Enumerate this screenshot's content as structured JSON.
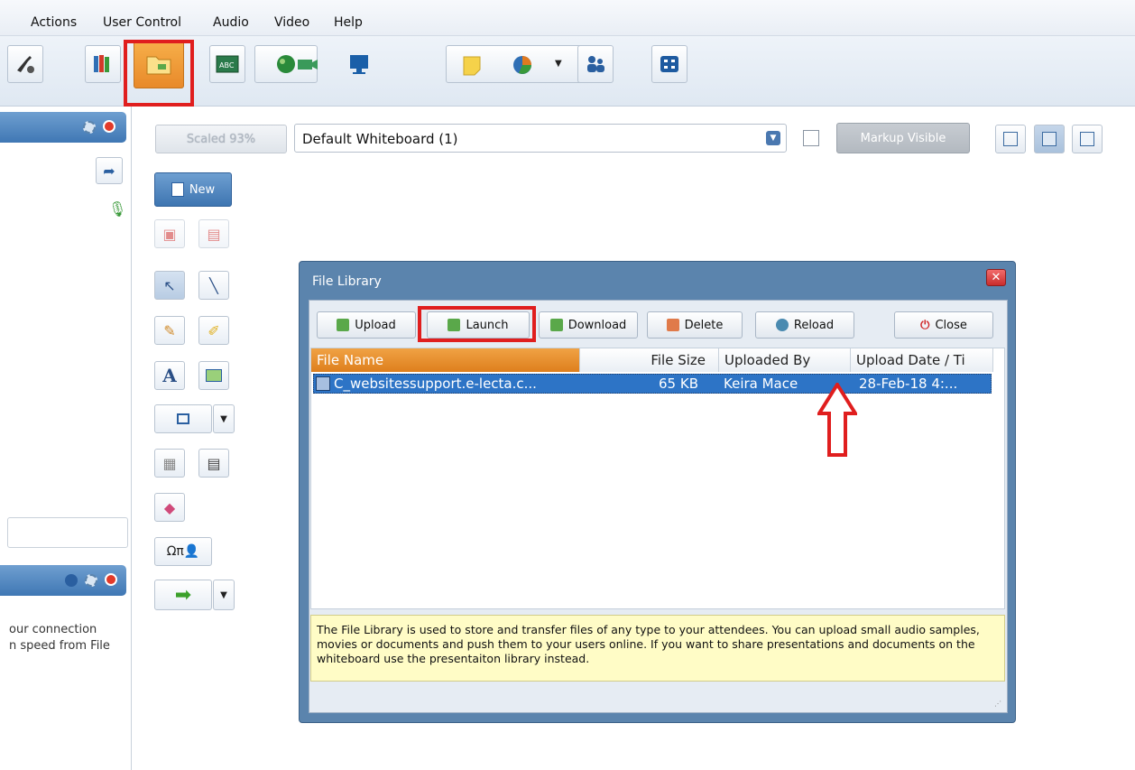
{
  "menu": {
    "items": [
      "Actions",
      "User Control",
      "Audio",
      "Video",
      "Help"
    ]
  },
  "toolbar": {
    "buttons": [
      {
        "name": "audio-settings-icon",
        "color": "#333333"
      },
      {
        "name": "library-books-icon",
        "color": "#2f6fb5"
      },
      {
        "name": "file-library-icon",
        "color": "#f0a040"
      },
      {
        "name": "whiteboard-abc-icon",
        "color": "#2a7a4a"
      },
      {
        "name": "web-browser-globe-icon",
        "color": "#2a8a3a"
      },
      {
        "name": "video-camera-icon",
        "color": "#3a9a5a"
      },
      {
        "name": "desktop-share-icon",
        "color": "#1a5fa8"
      },
      {
        "name": "sticky-note-icon",
        "color": "#f5d24a"
      },
      {
        "name": "polling-pie-icon",
        "color": "#e07a20"
      },
      {
        "name": "breakout-users-icon",
        "color": "#2a5fa0"
      },
      {
        "name": "fullscreen-icon",
        "color": "#1d5aa0"
      }
    ],
    "active_index": 2
  },
  "whiteboard": {
    "scaled_label": "Scaled 93%",
    "selected_board": "Default Whiteboard (1)",
    "markup_label": "Markup Visible",
    "new_label": "New"
  },
  "left_panel": {
    "status_line_1": "our connection",
    "status_line_2": "n speed from File"
  },
  "dialog": {
    "title": "File Library",
    "buttons": {
      "upload": "Upload",
      "launch": "Launch",
      "download": "Download",
      "delete": "Delete",
      "reload": "Reload",
      "close": "Close"
    },
    "columns": [
      "File Name",
      "File Size",
      "Uploaded By",
      "Upload Date / Ti"
    ],
    "rows": [
      {
        "file_name": "C_websitessupport.e-lecta.c...",
        "file_size": "65 KB",
        "uploaded_by": "Keira Mace",
        "upload_date": "28-Feb-18 4:..."
      }
    ],
    "info": "The File Library is used to store and transfer files of any type to your attendees. You can upload small audio samples, movies or documents and push them to your users online. If you want to share presentations and documents on the whiteboard use the presentaiton library instead."
  },
  "colors": {
    "accent_blue": "#3f77b4",
    "highlight_red": "#e01e1e",
    "selection_blue": "#2d74c6",
    "sorted_header_orange": "#de7f1d",
    "info_yellow": "#fffcc6"
  }
}
